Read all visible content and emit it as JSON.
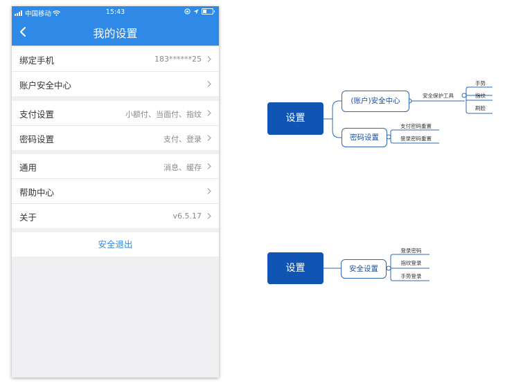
{
  "status_bar": {
    "carrier": "中国移动",
    "time": "15:43"
  },
  "nav": {
    "title": "我的设置"
  },
  "groups": [
    {
      "rows": [
        {
          "label": "绑定手机",
          "value": "183******25"
        },
        {
          "label": "账户安全中心",
          "value": ""
        }
      ]
    },
    {
      "rows": [
        {
          "label": "支付设置",
          "value": "小额付、当面付、指纹"
        },
        {
          "label": "密码设置",
          "value": "支付、登录"
        }
      ]
    },
    {
      "rows": [
        {
          "label": "通用",
          "value": "消息、缓存"
        },
        {
          "label": "帮助中心",
          "value": ""
        },
        {
          "label": "关于",
          "value": "v6.5.17"
        }
      ]
    }
  ],
  "logout_label": "安全退出",
  "mindmap_1": {
    "root": "设置",
    "branch_security": "(账户)安全中心",
    "branch_security_edge": "安全保护工具",
    "security_leaves": [
      "手势",
      "指纹",
      "刷脸"
    ],
    "branch_password": "密码设置",
    "password_leaves": [
      "支付密码重置",
      "登录密码重置"
    ]
  },
  "mindmap_2": {
    "root": "设置",
    "branch": "安全设置",
    "leaves": [
      "登录密码",
      "指纹登录",
      "手势登录"
    ]
  },
  "colors": {
    "accent": "#2e8ae6",
    "mindmap_root": "#1155b4",
    "mindmap_border": "#2f66b0"
  }
}
